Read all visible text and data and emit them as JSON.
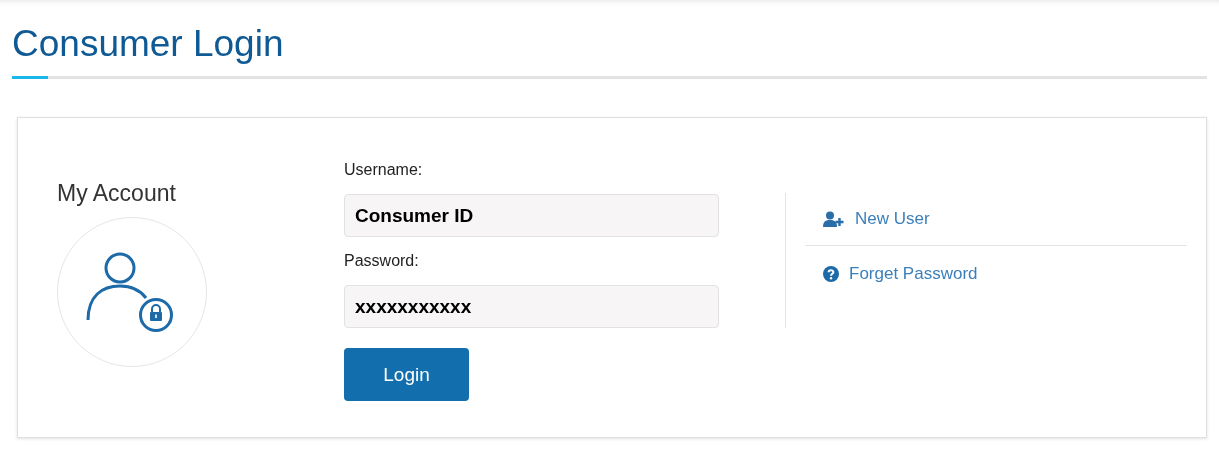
{
  "page": {
    "title": "Consumer Login"
  },
  "account": {
    "heading": "My Account"
  },
  "form": {
    "fields": [
      {
        "label": "Username:",
        "value": "Consumer ID"
      },
      {
        "label": "Password:",
        "value": "xxxxxxxxxxx"
      }
    ],
    "submit": "Login"
  },
  "links": [
    {
      "kind": "new-user",
      "label": "New User"
    },
    {
      "kind": "help",
      "label": "Forget Password"
    }
  ]
}
